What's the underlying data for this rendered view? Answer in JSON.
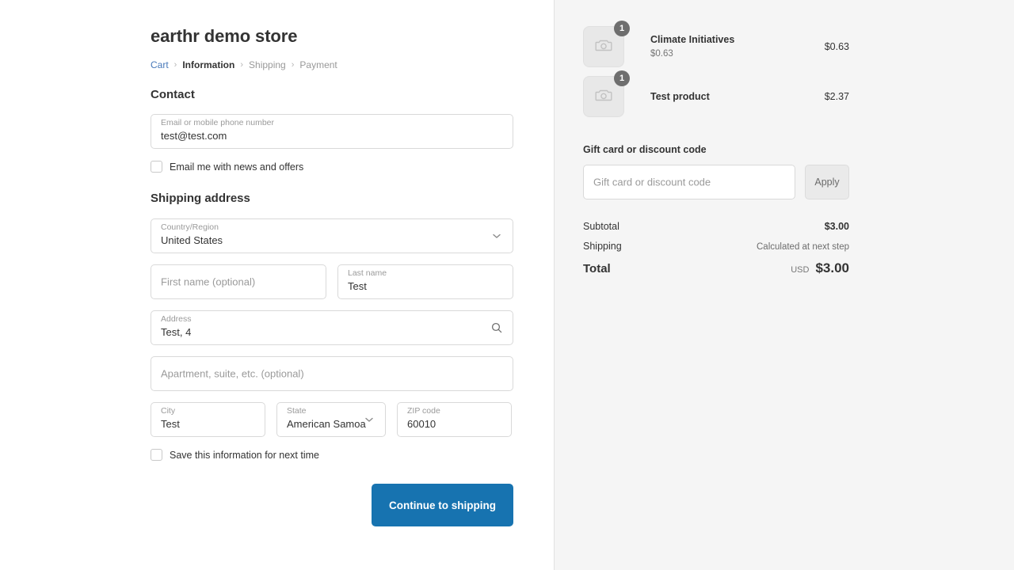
{
  "store": {
    "title": "earthr demo store"
  },
  "breadcrumb": {
    "cart": "Cart",
    "information": "Information",
    "shipping": "Shipping",
    "payment": "Payment",
    "separator": "›"
  },
  "contact": {
    "heading": "Contact",
    "email_label": "Email or mobile phone number",
    "email_value": "test@test.com",
    "newsletter_label": "Email me with news and offers"
  },
  "shipping_address": {
    "heading": "Shipping address",
    "country_label": "Country/Region",
    "country_value": "United States",
    "first_name_placeholder": "First name (optional)",
    "last_name_label": "Last name",
    "last_name_value": "Test",
    "address_label": "Address",
    "address_value": "Test, 4",
    "apartment_placeholder": "Apartment, suite, etc. (optional)",
    "city_label": "City",
    "city_value": "Test",
    "state_label": "State",
    "state_value": "American Samoa",
    "zip_label": "ZIP code",
    "zip_value": "60010",
    "save_info_label": "Save this information for next time"
  },
  "actions": {
    "continue_label": "Continue to shipping"
  },
  "order_summary": {
    "items": [
      {
        "name": "Climate Initiatives",
        "variant": "$0.63",
        "quantity": "1",
        "price": "$0.63"
      },
      {
        "name": "Test product",
        "variant": "",
        "quantity": "1",
        "price": "$2.37"
      }
    ],
    "discount_heading": "Gift card or discount code",
    "discount_placeholder": "Gift card or discount code",
    "apply_label": "Apply",
    "subtotal_label": "Subtotal",
    "subtotal_value": "$3.00",
    "shipping_label": "Shipping",
    "shipping_value": "Calculated at next step",
    "total_label": "Total",
    "total_currency": "USD",
    "total_value": "$3.00"
  },
  "colors": {
    "accent": "#1773b0",
    "link": "#4778b9",
    "sidebar_bg": "#f5f5f5",
    "badge": "#6e6e6e"
  }
}
